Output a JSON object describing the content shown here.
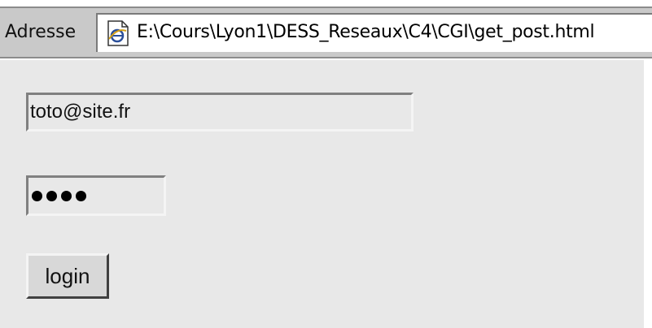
{
  "address_bar": {
    "label": "Adresse",
    "url": "E:\\Cours\\Lyon1\\DESS_Reseaux\\C4\\CGI\\get_post.html"
  },
  "form": {
    "email_value": "toto@site.fr",
    "password_mask_count": 4,
    "login_label": "login"
  },
  "icons": {
    "address_icon": "ie-page-icon"
  },
  "colors": {
    "content_background": "#e8e8e8",
    "toolbar_background": "#c9c9c9"
  }
}
